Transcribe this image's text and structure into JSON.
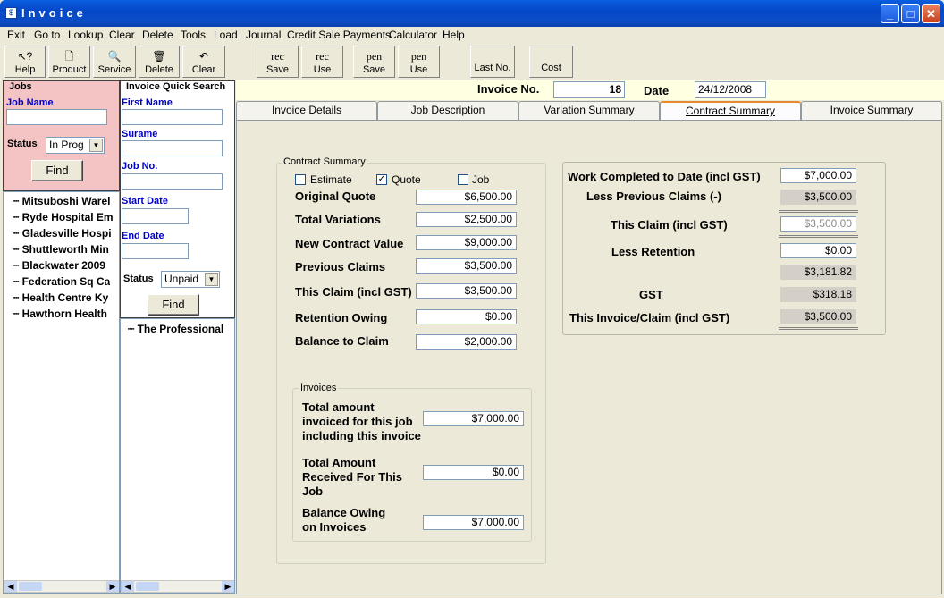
{
  "window": {
    "title": "Invoice"
  },
  "menu": [
    "Exit",
    "Go to",
    "Lookup",
    "Clear",
    "Delete",
    "Tools",
    "Load",
    "Journal",
    "Credit Sale Payments",
    "Calculator",
    "Help"
  ],
  "toolbar": {
    "help": "Help",
    "product": "Product",
    "service": "Service",
    "delete": "Delete",
    "clear": "Clear",
    "rec_save_top": "rec",
    "rec_save": "Save",
    "rec_use_top": "rec",
    "rec_use": "Use",
    "pen_save_top": "pen",
    "pen_save": "Save",
    "pen_use_top": "pen",
    "pen_use": "Use",
    "last_no": "Last No.",
    "cost": "Cost"
  },
  "jobs": {
    "title": "Jobs",
    "job_name_label": "Job Name",
    "job_name_value": "",
    "status_label": "Status",
    "status_value": "In Prog",
    "find": "Find",
    "list": [
      "Mitsuboshi Warel",
      "Ryde Hospital Em",
      "Gladesville Hospi",
      "Shuttleworth Min",
      "Blackwater 2009",
      "Federation Sq Ca",
      "Health Centre Ky",
      "Hawthorn Health"
    ]
  },
  "quick_search": {
    "title": "Invoice Quick Search",
    "first_name": "First Name",
    "surname": "Surame",
    "job_no": "Job No.",
    "start_date": "Start Date",
    "end_date": "End Date",
    "status_label": "Status",
    "status_value": "Unpaid",
    "find": "Find",
    "list": [
      "The Professional"
    ]
  },
  "header": {
    "invoice_no_label": "Invoice No.",
    "invoice_no": "18",
    "date_label": "Date",
    "date": "24/12/2008"
  },
  "tabs": [
    "Invoice Details",
    "Job Description",
    "Variation Summary",
    "Contract Summary",
    "Invoice Summary"
  ],
  "contract_summary": {
    "group_label": "Contract Summary",
    "estimate": "Estimate",
    "quote": "Quote",
    "job": "Job",
    "rows": [
      {
        "label": "Original Quote",
        "value": "$6,500.00"
      },
      {
        "label": "Total Variations",
        "value": "$2,500.00"
      },
      {
        "label": "New Contract Value",
        "value": "$9,000.00"
      },
      {
        "label": "Previous Claims",
        "value": "$3,500.00"
      },
      {
        "label": "This Claim (incl GST)",
        "value": "$3,500.00"
      },
      {
        "label": "Retention Owing",
        "value": "$0.00"
      },
      {
        "label": "Balance to Claim",
        "value": "$2,000.00"
      }
    ]
  },
  "invoices": {
    "group_label": "Invoices",
    "total_invoiced_l1": "Total amount",
    "total_invoiced_l2": "invoiced for this job",
    "total_invoiced_l3": "including this invoice",
    "total_invoiced": "$7,000.00",
    "received_l1": "Total Amount",
    "received_l2": "Received For This",
    "received_l3": "Job",
    "received": "$0.00",
    "balance_l1": "Balance Owing",
    "balance_l2": "on Invoices",
    "balance": "$7,000.00"
  },
  "claim": {
    "work_completed_label": "Work Completed to Date (incl GST)",
    "work_completed": "$7,000.00",
    "less_prev_label": "Less Previous Claims (-)",
    "less_prev": "$3,500.00",
    "this_claim_label": "This Claim (incl GST)",
    "this_claim": "$3,500.00",
    "less_retention_label": "Less Retention",
    "less_retention": "$0.00",
    "subtotal": "$3,181.82",
    "gst_label": "GST",
    "gst": "$318.18",
    "this_invoice_label": "This Invoice/Claim (incl GST)",
    "this_invoice": "$3,500.00"
  }
}
